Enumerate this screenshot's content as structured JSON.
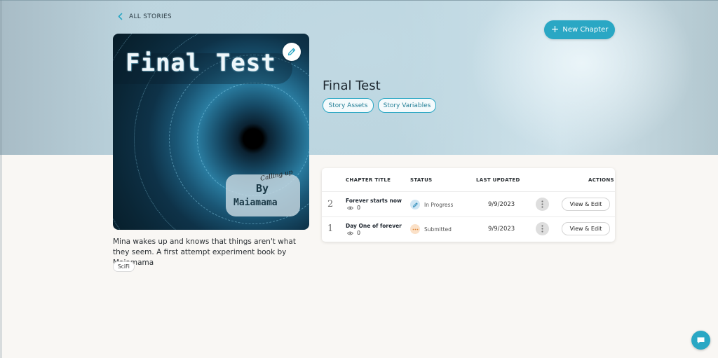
{
  "nav": {
    "back_label": "ALL STORIES"
  },
  "actions": {
    "new_chapter_label": "New Chapter"
  },
  "cover": {
    "title_text": "Final Test",
    "calling_text": "Calling up",
    "by_text": "By",
    "author_text": "Maiamama"
  },
  "story": {
    "title": "Final Test",
    "description": "Mina wakes up and knows that things aren't what they seem. A first attempt experiment book by Maiamama",
    "tag": "SciFi",
    "buttons": {
      "assets": "Story Assets",
      "variables": "Story Variables"
    }
  },
  "table": {
    "headers": {
      "chapter_title": "CHAPTER TITLE",
      "status": "STATUS",
      "last_updated": "LAST UPDATED",
      "actions": "ACTIONS"
    },
    "rows": [
      {
        "number": "2",
        "title": "Forever starts now",
        "views": "0",
        "status": "In Progress",
        "status_icon": "pencil-icon",
        "status_color": "#cfe6f4",
        "last_updated": "9/9/2023",
        "action_label": "View & Edit"
      },
      {
        "number": "1",
        "title": "Day One of forever",
        "views": "0",
        "status": "Submitted",
        "status_icon": "ellipsis-icon",
        "status_color": "#fbe1c8",
        "last_updated": "9/9/2023",
        "action_label": "View & Edit"
      }
    ]
  },
  "colors": {
    "accent": "#2aa7c4",
    "background": "#f9f7f4"
  }
}
